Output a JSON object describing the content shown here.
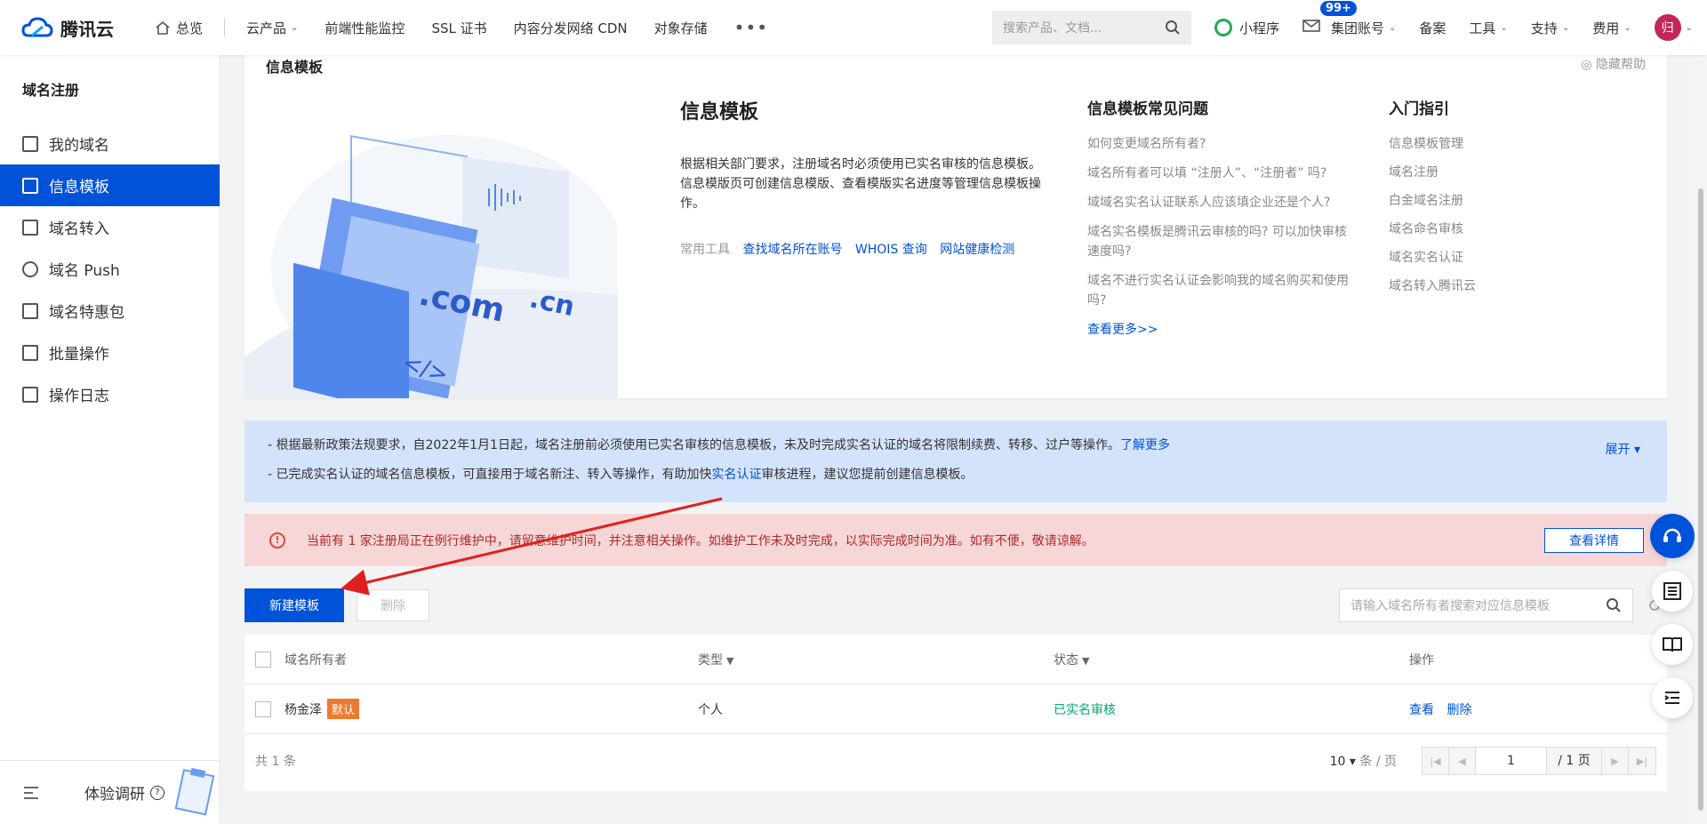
{
  "topbar": {
    "brand": "腾讯云",
    "nav": [
      {
        "label": "总览"
      },
      {
        "label": "云产品"
      },
      {
        "label": "前端性能监控"
      },
      {
        "label": "SSL 证书"
      },
      {
        "label": "内容分发网络 CDN"
      },
      {
        "label": "对象存储"
      }
    ],
    "more": "•••",
    "search_placeholder": "搜索产品、文档...",
    "right": {
      "miniprogram": "小程序",
      "mail_badge": "99+",
      "group_account": "集团账号",
      "beian": "备案",
      "tools": "工具",
      "support": "支持",
      "billing": "费用",
      "avatar": "归"
    }
  },
  "sidebar": {
    "title": "域名注册",
    "items": [
      {
        "label": "我的域名"
      },
      {
        "label": "信息模板"
      },
      {
        "label": "域名转入"
      },
      {
        "label": "域名 Push"
      },
      {
        "label": "域名特惠包"
      },
      {
        "label": "批量操作"
      },
      {
        "label": "操作日志"
      }
    ],
    "footer": "体验调研",
    "footer_q": "?"
  },
  "help": {
    "heading": "信息模板",
    "hide": "隐藏帮助",
    "intro_title": "信息模板",
    "intro_desc": "根据相关部门要求，注册域名时必须使用已实名审核的信息模板。信息模版页可创建信息模版、查看模版实名进度等管理信息模板操作。",
    "tools_label": "常用工具",
    "tools": [
      "查找域名所在账号",
      "WHOIS 查询",
      "网站健康检测"
    ],
    "faq_title": "信息模板常见问题",
    "faq": [
      "如何变更域名所有者?",
      "域名所有者可以填 “注册人”、“注册者” 吗?",
      "域域名实名认证联系人应该填企业还是个人?",
      "域名实名模板是腾讯云审核的吗? 可以加快审核速度吗?",
      "域名不进行实名认证会影响我的域名购买和使用吗?"
    ],
    "faq_more": "查看更多>>",
    "guide_title": "入门指引",
    "guide": [
      "信息模板管理",
      "域名注册",
      "白金域名注册",
      "域名命名审核",
      "域名实名认证",
      "域名转入腾讯云"
    ],
    "illus_com": ".com",
    "illus_cn": ".cn",
    "illus_code": "</>"
  },
  "notice": {
    "line1": "- 根据最新政策法规要求，自2022年1月1日起，域名注册前必须使用已实名审核的信息模板，未及时完成实名认证的域名将限制续费、转移、过户等操作。",
    "line1_link": "了解更多",
    "line2_pre": "- 已完成实名认证的域名信息模板，可直接用于域名新注、转入等操作，有助加快",
    "line2_link": "实名认证",
    "line2_post": "审核进程，建议您提前创建信息模板。",
    "expand": "展开"
  },
  "warning": {
    "text": "当前有 1 家注册局正在例行维护中，请留意维护时间，并注意相关操作。如维护工作未及时完成，以实际完成时间为准。如有不便，敬请谅解。",
    "button": "查看详情"
  },
  "toolbar": {
    "create": "新建模板",
    "delete": "删除",
    "search_placeholder": "请输入域名所有者搜索对应信息模板"
  },
  "table": {
    "headers": [
      "域名所有者",
      "类型",
      "状态",
      "操作"
    ],
    "rows": [
      {
        "owner": "杨金泽",
        "tag": "默认",
        "type": "个人",
        "status": "已实名审核",
        "ops": [
          "查看",
          "删除"
        ]
      }
    ],
    "total": "共 1 条",
    "page_size": "10",
    "page_size_unit": "条 / 页",
    "page": "1",
    "page_total": "/ 1 页"
  },
  "colors": {
    "primary": "#0052d9",
    "success": "#00a870",
    "warning_bg": "#f6d6d6",
    "notice_bg": "#d4e3fc",
    "tag": "#ed7b2f",
    "arrow": "#e02020"
  }
}
